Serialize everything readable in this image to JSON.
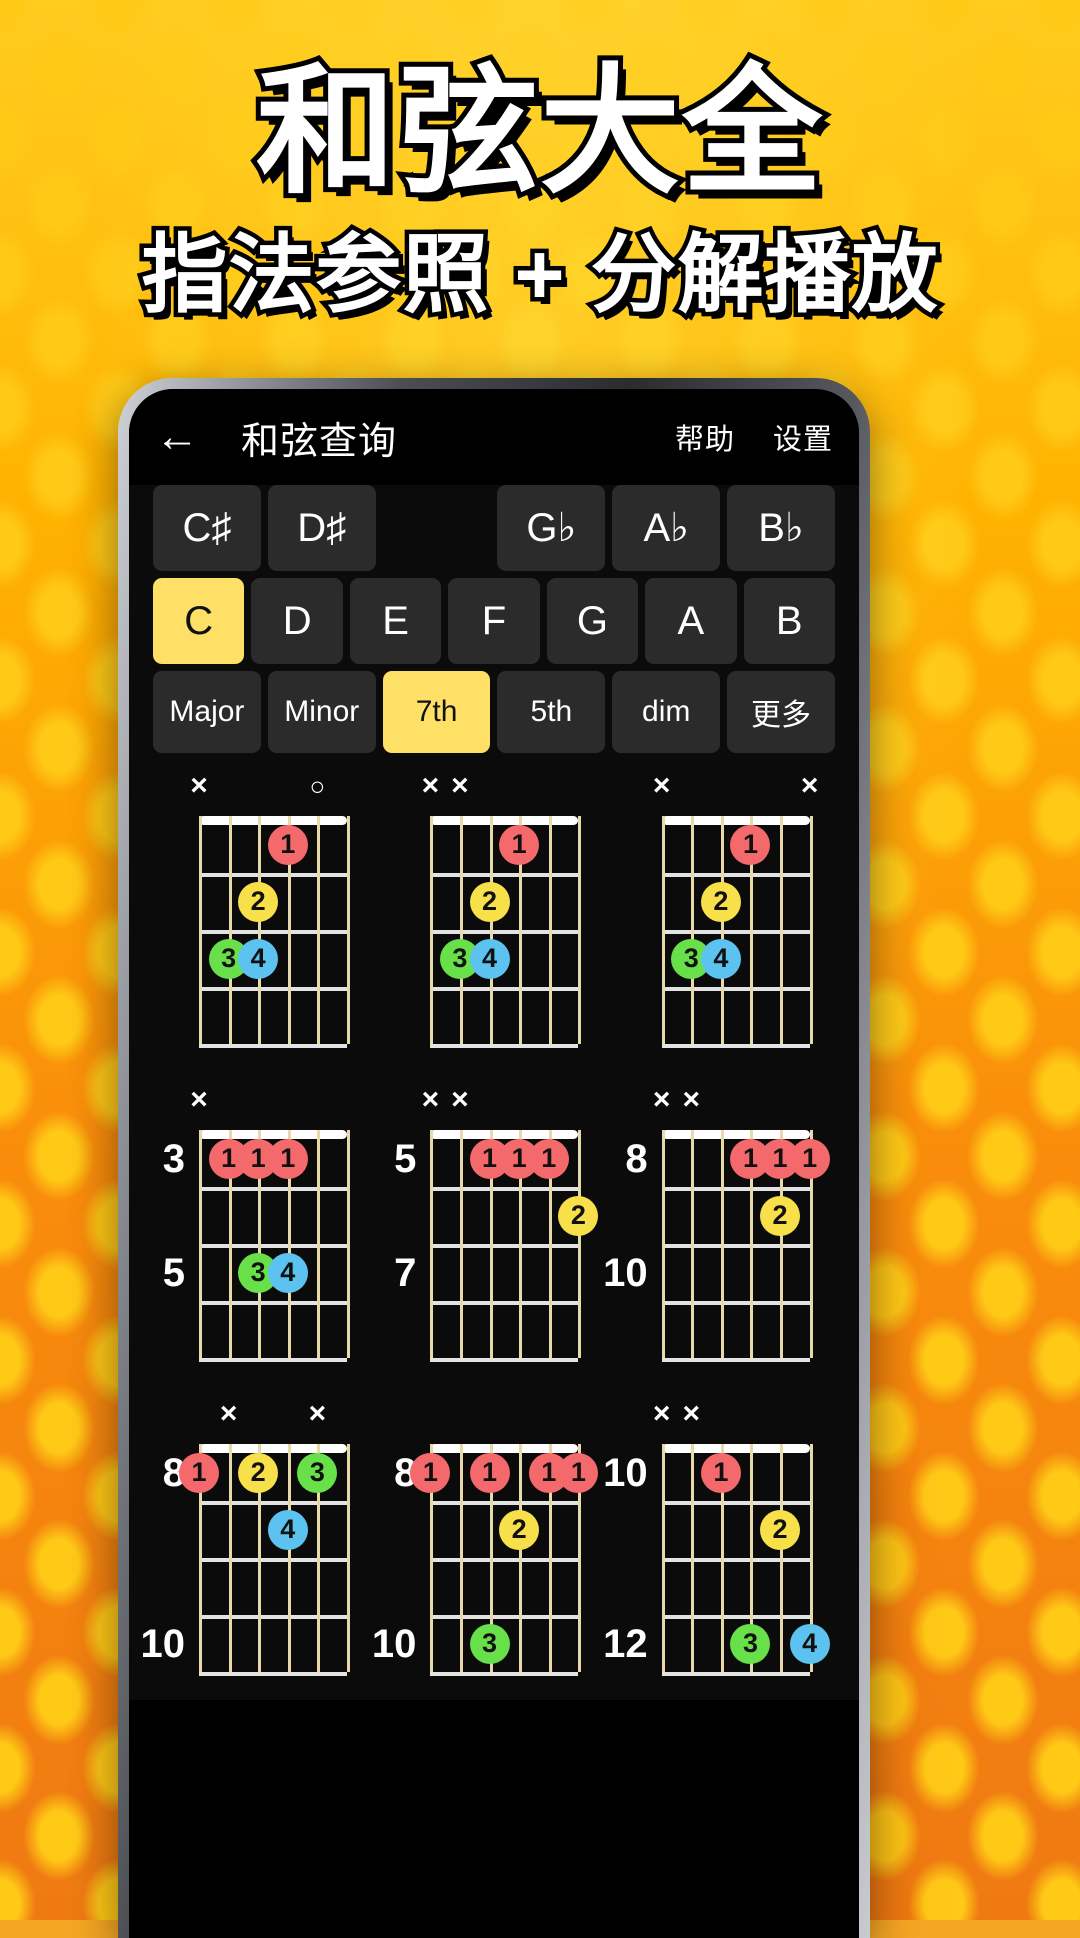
{
  "promo": {
    "title": "和弦大全",
    "subtitle": "指法参照 + 分解播放"
  },
  "colors": {
    "accent": "#ffe066",
    "background": "#f59c0b",
    "app_background": "#0b0b0b",
    "finger1": "#f4696b",
    "finger2": "#f7e04a",
    "finger3": "#68e04a",
    "finger4": "#5cc3f0"
  },
  "appbar": {
    "back_icon": "arrow-left-icon",
    "back_glyph": "←",
    "title": "和弦查询",
    "actions": [
      {
        "label": "帮助"
      },
      {
        "label": "设置"
      }
    ]
  },
  "selectors": {
    "accidentals": [
      {
        "label": "C♯",
        "selected": false,
        "blank": false
      },
      {
        "label": "D♯",
        "selected": false,
        "blank": false
      },
      {
        "label": "",
        "selected": false,
        "blank": true
      },
      {
        "label": "G♭",
        "selected": false,
        "blank": false
      },
      {
        "label": "A♭",
        "selected": false,
        "blank": false
      },
      {
        "label": "B♭",
        "selected": false,
        "blank": false
      }
    ],
    "naturals": [
      {
        "label": "C",
        "selected": true
      },
      {
        "label": "D",
        "selected": false
      },
      {
        "label": "E",
        "selected": false
      },
      {
        "label": "F",
        "selected": false
      },
      {
        "label": "G",
        "selected": false
      },
      {
        "label": "A",
        "selected": false
      },
      {
        "label": "B",
        "selected": false
      }
    ],
    "types": [
      {
        "label": "Major",
        "selected": false
      },
      {
        "label": "Minor",
        "selected": false
      },
      {
        "label": "7th",
        "selected": true
      },
      {
        "label": "5th",
        "selected": false
      },
      {
        "label": "dim",
        "selected": false
      },
      {
        "label": "更多",
        "selected": false
      }
    ]
  },
  "chord_diagrams": [
    {
      "id": "c7-open-1",
      "start_fret_labels": [],
      "top_marks": [
        {
          "string": 0,
          "glyph": "×"
        },
        {
          "string": 4,
          "glyph": "○"
        }
      ],
      "dots": [
        {
          "string": 3,
          "fret": 1,
          "finger": "1"
        },
        {
          "string": 2,
          "fret": 2,
          "finger": "2"
        },
        {
          "string": 1,
          "fret": 3,
          "finger": "3"
        },
        {
          "string": 2,
          "fret": 3,
          "finger": "4"
        }
      ]
    },
    {
      "id": "c7-open-2",
      "start_fret_labels": [],
      "top_marks": [
        {
          "string": 0,
          "glyph": "×"
        },
        {
          "string": 1,
          "glyph": "×"
        }
      ],
      "dots": [
        {
          "string": 3,
          "fret": 1,
          "finger": "1"
        },
        {
          "string": 2,
          "fret": 2,
          "finger": "2"
        },
        {
          "string": 1,
          "fret": 3,
          "finger": "3"
        },
        {
          "string": 2,
          "fret": 3,
          "finger": "4"
        }
      ]
    },
    {
      "id": "c7-open-3",
      "start_fret_labels": [],
      "top_marks": [
        {
          "string": 0,
          "glyph": "×"
        },
        {
          "string": 5,
          "glyph": "×"
        }
      ],
      "dots": [
        {
          "string": 3,
          "fret": 1,
          "finger": "1"
        },
        {
          "string": 2,
          "fret": 2,
          "finger": "2"
        },
        {
          "string": 1,
          "fret": 3,
          "finger": "3"
        },
        {
          "string": 2,
          "fret": 3,
          "finger": "4"
        }
      ]
    },
    {
      "id": "c7-fret3",
      "start_fret_labels": [
        {
          "fret": 1,
          "label": "3"
        },
        {
          "fret": 3,
          "label": "5"
        }
      ],
      "top_marks": [
        {
          "string": 0,
          "glyph": "×"
        }
      ],
      "dots": [
        {
          "string": 1,
          "fret": 1,
          "finger": "1"
        },
        {
          "string": 2,
          "fret": 1,
          "finger": "1"
        },
        {
          "string": 3,
          "fret": 1,
          "finger": "1"
        },
        {
          "string": 2,
          "fret": 3,
          "finger": "3"
        },
        {
          "string": 3,
          "fret": 3,
          "finger": "4"
        }
      ]
    },
    {
      "id": "c7-fret5",
      "start_fret_labels": [
        {
          "fret": 1,
          "label": "5"
        },
        {
          "fret": 3,
          "label": "7"
        }
      ],
      "top_marks": [
        {
          "string": 0,
          "glyph": "×"
        },
        {
          "string": 1,
          "glyph": "×"
        }
      ],
      "dots": [
        {
          "string": 2,
          "fret": 1,
          "finger": "1"
        },
        {
          "string": 3,
          "fret": 1,
          "finger": "1"
        },
        {
          "string": 4,
          "fret": 1,
          "finger": "1"
        },
        {
          "string": 5,
          "fret": 2,
          "finger": "2"
        }
      ]
    },
    {
      "id": "c7-fret8a",
      "start_fret_labels": [
        {
          "fret": 1,
          "label": "8"
        },
        {
          "fret": 3,
          "label": "10"
        }
      ],
      "top_marks": [
        {
          "string": 0,
          "glyph": "×"
        },
        {
          "string": 1,
          "glyph": "×"
        }
      ],
      "dots": [
        {
          "string": 3,
          "fret": 1,
          "finger": "1"
        },
        {
          "string": 4,
          "fret": 1,
          "finger": "1"
        },
        {
          "string": 5,
          "fret": 1,
          "finger": "1"
        },
        {
          "string": 4,
          "fret": 2,
          "finger": "2"
        }
      ]
    },
    {
      "id": "c7-fret8b",
      "start_fret_labels": [
        {
          "fret": 1,
          "label": "8"
        },
        {
          "fret": 4,
          "label": "10"
        }
      ],
      "top_marks": [
        {
          "string": 1,
          "glyph": "×"
        },
        {
          "string": 4,
          "glyph": "×"
        }
      ],
      "dots": [
        {
          "string": 0,
          "fret": 1,
          "finger": "1"
        },
        {
          "string": 2,
          "fret": 1,
          "finger": "2"
        },
        {
          "string": 4,
          "fret": 1,
          "finger": "3"
        },
        {
          "string": 3,
          "fret": 2,
          "finger": "4"
        }
      ]
    },
    {
      "id": "c7-fret8c",
      "start_fret_labels": [
        {
          "fret": 1,
          "label": "8"
        },
        {
          "fret": 4,
          "label": "10"
        }
      ],
      "top_marks": [],
      "dots": [
        {
          "string": 0,
          "fret": 1,
          "finger": "1"
        },
        {
          "string": 2,
          "fret": 1,
          "finger": "1"
        },
        {
          "string": 4,
          "fret": 1,
          "finger": "1"
        },
        {
          "string": 5,
          "fret": 1,
          "finger": "1"
        },
        {
          "string": 3,
          "fret": 2,
          "finger": "2"
        },
        {
          "string": 2,
          "fret": 4,
          "finger": "3"
        }
      ]
    },
    {
      "id": "c7-fret10",
      "start_fret_labels": [
        {
          "fret": 1,
          "label": "10"
        },
        {
          "fret": 4,
          "label": "12"
        }
      ],
      "top_marks": [
        {
          "string": 0,
          "glyph": "×"
        },
        {
          "string": 1,
          "glyph": "×"
        }
      ],
      "dots": [
        {
          "string": 2,
          "fret": 1,
          "finger": "1"
        },
        {
          "string": 4,
          "fret": 2,
          "finger": "2"
        },
        {
          "string": 3,
          "fret": 4,
          "finger": "3"
        },
        {
          "string": 5,
          "fret": 4,
          "finger": "4"
        }
      ]
    }
  ]
}
